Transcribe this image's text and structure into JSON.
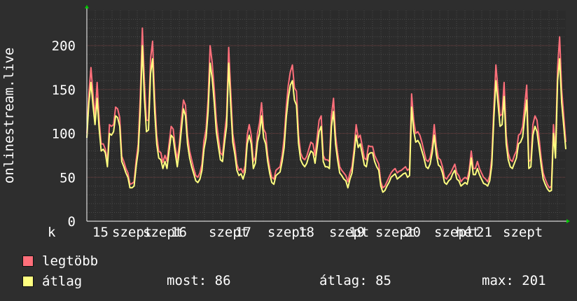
{
  "chart_data": {
    "type": "area",
    "ylabel": "onlinestream.live",
    "ylim": [
      0,
      240
    ],
    "yticks": [
      0,
      50,
      100,
      150,
      200
    ],
    "grid": true,
    "xticks": [
      "k 15",
      "szept",
      "szept 16",
      "szept",
      "17",
      "szept",
      "18",
      "szept",
      "19",
      "szept",
      "20",
      "szept",
      "hét",
      "21",
      "szept"
    ],
    "series": [
      {
        "name": "legtöbb",
        "color": "#ff6f7a",
        "values": [
          100,
          145,
          175,
          145,
          118,
          158,
          115,
          88,
          88,
          82,
          68,
          110,
          108,
          110,
          130,
          128,
          118,
          74,
          68,
          60,
          55,
          42,
          43,
          45,
          70,
          88,
          142,
          220,
          160,
          115,
          115,
          185,
          205,
          140,
          98,
          80,
          78,
          67,
          75,
          68,
          88,
          108,
          105,
          85,
          70,
          88,
          115,
          138,
          132,
          98,
          80,
          70,
          60,
          52,
          50,
          55,
          65,
          92,
          105,
          140,
          200,
          180,
          150,
          115,
          95,
          78,
          75,
          100,
          120,
          198,
          148,
          100,
          85,
          65,
          58,
          60,
          55,
          63,
          98,
          110,
          98,
          68,
          73,
          100,
          112,
          135,
          105,
          100,
          75,
          60,
          50,
          48,
          58,
          60,
          62,
          75,
          95,
          130,
          155,
          170,
          178,
          152,
          148,
          98,
          78,
          72,
          70,
          74,
          82,
          90,
          88,
          75,
          95,
          115,
          120,
          75,
          70,
          70,
          68,
          120,
          140,
          98,
          78,
          62,
          58,
          55,
          52,
          45,
          55,
          62,
          82,
          110,
          95,
          98,
          85,
          72,
          70,
          86,
          85,
          85,
          75,
          70,
          65,
          45,
          38,
          40,
          45,
          50,
          55,
          58,
          60,
          55,
          57,
          58,
          60,
          62,
          58,
          60,
          145,
          115,
          100,
          102,
          98,
          90,
          80,
          70,
          68,
          72,
          85,
          110,
          85,
          72,
          70,
          62,
          50,
          48,
          52,
          55,
          60,
          65,
          55,
          52,
          45,
          48,
          50,
          48,
          58,
          80,
          60,
          60,
          68,
          60,
          55,
          50,
          48,
          45,
          52,
          72,
          130,
          178,
          150,
          120,
          122,
          158,
          98,
          78,
          70,
          68,
          75,
          80,
          98,
          100,
          108,
          132,
          155,
          68,
          70,
          110,
          120,
          115,
          95,
          72,
          55,
          48,
          42,
          38,
          40,
          110,
          80,
          175,
          210,
          150,
          120,
          90
        ]
      },
      {
        "name": "átlag",
        "color": "#ffff80",
        "values": [
          95,
          135,
          158,
          132,
          110,
          140,
          105,
          80,
          82,
          78,
          62,
          100,
          98,
          102,
          120,
          118,
          108,
          68,
          62,
          55,
          50,
          38,
          38,
          40,
          63,
          80,
          125,
          200,
          140,
          102,
          104,
          168,
          185,
          125,
          88,
          72,
          70,
          60,
          68,
          60,
          80,
          98,
          95,
          78,
          62,
          80,
          104,
          128,
          120,
          88,
          72,
          62,
          54,
          46,
          44,
          48,
          58,
          82,
          95,
          125,
          180,
          162,
          135,
          102,
          85,
          70,
          68,
          90,
          108,
          180,
          132,
          90,
          76,
          58,
          52,
          54,
          48,
          56,
          88,
          98,
          88,
          60,
          66,
          90,
          100,
          120,
          95,
          88,
          68,
          54,
          44,
          42,
          52,
          54,
          56,
          68,
          84,
          118,
          140,
          155,
          160,
          138,
          132,
          88,
          70,
          65,
          62,
          66,
          74,
          80,
          78,
          66,
          84,
          102,
          108,
          68,
          62,
          62,
          60,
          108,
          125,
          88,
          70,
          55,
          52,
          48,
          46,
          38,
          48,
          55,
          75,
          98,
          84,
          88,
          76,
          64,
          62,
          76,
          78,
          78,
          68,
          62,
          58,
          40,
          33,
          35,
          40,
          44,
          50,
          52,
          54,
          48,
          50,
          52,
          54,
          55,
          50,
          52,
          130,
          103,
          90,
          92,
          88,
          80,
          72,
          62,
          60,
          65,
          78,
          98,
          76,
          64,
          62,
          55,
          44,
          42,
          46,
          48,
          54,
          58,
          48,
          46,
          40,
          42,
          44,
          42,
          52,
          72,
          53,
          53,
          60,
          53,
          48,
          43,
          42,
          40,
          46,
          64,
          118,
          160,
          135,
          108,
          110,
          142,
          88,
          70,
          62,
          60,
          66,
          72,
          88,
          90,
          96,
          118,
          138,
          60,
          62,
          98,
          108,
          102,
          84,
          64,
          48,
          42,
          37,
          34,
          35,
          100,
          72,
          160,
          185,
          135,
          108,
          82
        ]
      }
    ]
  },
  "legend": {
    "max_label": "legtöbb",
    "avg_label": "átlag"
  },
  "stats": {
    "now": "most: 86",
    "avg": "átlag: 85",
    "max": "max: 201"
  }
}
